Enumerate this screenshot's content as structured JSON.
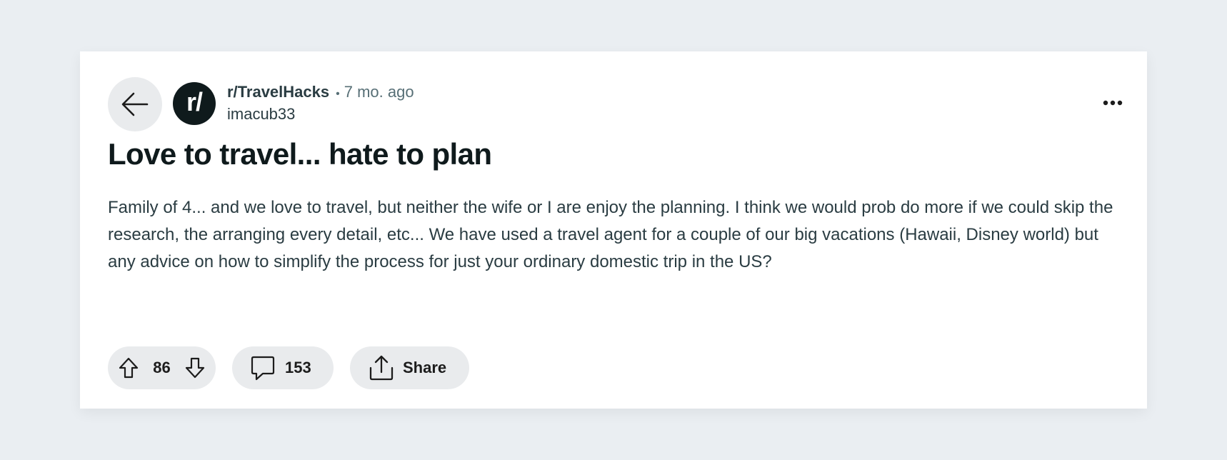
{
  "post": {
    "subreddit": "r/TravelHacks",
    "separator": "•",
    "age": "7 mo. ago",
    "author": "imacub33",
    "avatar_text": "r/",
    "title": "Love to travel... hate to plan",
    "body": "Family of 4... and we love to travel, but neither the wife or I are enjoy the planning. I think we would prob do more if we could skip the research, the arranging every detail, etc... We have used a travel agent for a couple of our big vacations (Hawaii, Disney world) but any advice on how to simplify the process for just your ordinary domestic trip in the US?"
  },
  "actions": {
    "votes": "86",
    "comments": "153",
    "share_label": "Share"
  },
  "icons": {
    "back": "arrow-left-icon",
    "more": "more-horizontal-icon",
    "upvote": "arrow-up-outline-icon",
    "downvote": "arrow-down-outline-icon",
    "comment": "comment-bubble-icon",
    "share": "share-upload-icon"
  },
  "colors": {
    "page_background": "#eaeef2",
    "card_background": "#ffffff",
    "pill_background": "#e9ebed",
    "avatar_background": "#0f1a1c",
    "text_primary": "#0f1a1c",
    "text_secondary": "#576f76"
  }
}
